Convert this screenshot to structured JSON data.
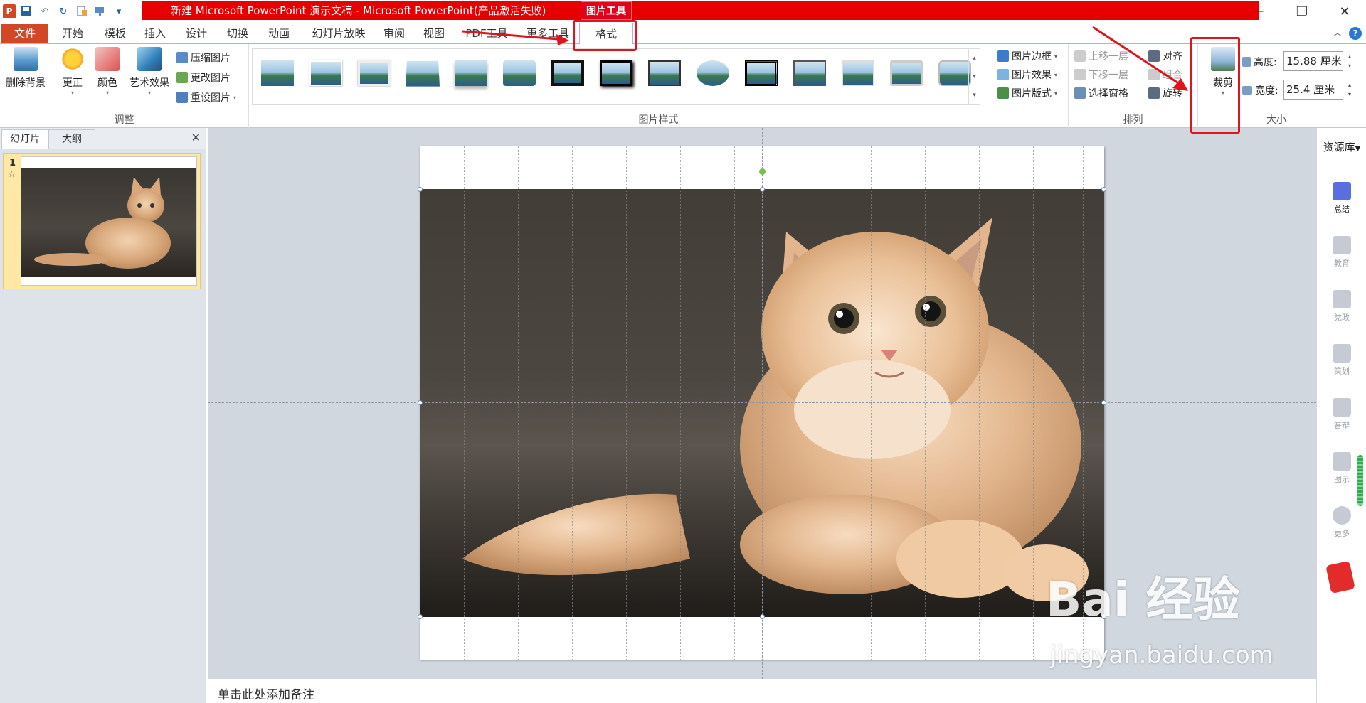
{
  "window": {
    "title": "新建 Microsoft PowerPoint 演示文稿 - Microsoft PowerPoint(产品激活失败)",
    "context_tab_header": "图片工具"
  },
  "ribbon_tabs": [
    {
      "label": "文件"
    },
    {
      "label": "开始"
    },
    {
      "label": "模板"
    },
    {
      "label": "插入"
    },
    {
      "label": "设计"
    },
    {
      "label": "切换"
    },
    {
      "label": "动画"
    },
    {
      "label": "幻灯片放映"
    },
    {
      "label": "审阅"
    },
    {
      "label": "视图"
    },
    {
      "label": "PDF工具"
    },
    {
      "label": "更多工具"
    },
    {
      "label": "格式"
    }
  ],
  "adjust_group": {
    "label": "调整",
    "remove_bg": "删除背景",
    "corrections": "更正",
    "color": "颜色",
    "art_effects": "艺术效果",
    "compress": "压缩图片",
    "change": "更改图片",
    "reset": "重设图片"
  },
  "styles_group": {
    "label": "图片样式",
    "border": "图片边框",
    "effects": "图片效果",
    "layout": "图片版式"
  },
  "arrange_group": {
    "label": "排列",
    "bring_forward": "上移一层",
    "send_backward": "下移一层",
    "selection_pane": "选择窗格",
    "align": "对齐",
    "group": "组合",
    "rotate": "旋转"
  },
  "size_group": {
    "label": "大小",
    "crop": "裁剪",
    "height_label": "高度:",
    "height_value": "15.88 厘米",
    "width_label": "宽度:",
    "width_value": "25.4 厘米"
  },
  "left_pane": {
    "tab_slides": "幻灯片",
    "tab_outline": "大纲",
    "close": "✕",
    "slide_number": "1",
    "slide_star": "☆"
  },
  "notes": {
    "placeholder": "单击此处添加备注"
  },
  "right_sidebar": {
    "title": "资源库",
    "items": [
      {
        "label": "总结"
      },
      {
        "label": "教育"
      },
      {
        "label": "党政"
      },
      {
        "label": "策划"
      },
      {
        "label": "答辩"
      },
      {
        "label": "图示"
      },
      {
        "label": "更多"
      }
    ]
  },
  "watermark": {
    "text": "Bai  经验",
    "sub": "jingyan.baidu.com"
  },
  "colors": {
    "accent_red": "#e60000",
    "file_tab": "#d24726",
    "annotation": "#e0141e"
  }
}
